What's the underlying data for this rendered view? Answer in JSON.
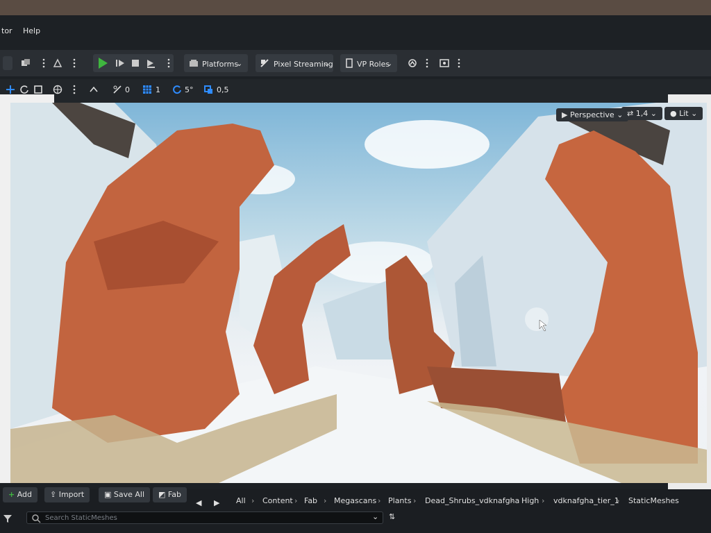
{
  "menu": {
    "partial_left": "tor",
    "help": "Help"
  },
  "toolbar": {
    "platforms": "Platforms",
    "pixel_streaming": "Pixel Streaming",
    "vp_roles": "VP Roles"
  },
  "transform_bar": {
    "rotation_snap": "0",
    "grid_snap": "1",
    "angle_snap": "5°",
    "scale_snap": "0,5"
  },
  "viewport": {
    "view_mode": "Perspective",
    "camera_speed": "1,4",
    "lighting_mode": "Lit"
  },
  "content_browser": {
    "add_label": "Add",
    "import_label": "Import",
    "save_all_label": "Save All",
    "fab_label": "Fab",
    "breadcrumb": [
      "All",
      "Content",
      "Fab",
      "Megascans",
      "Plants",
      "Dead_Shrubs_vdknafgha",
      "High",
      "vdknafgha_tier_1",
      "StaticMeshes"
    ],
    "search_placeholder": "Search StaticMeshes"
  },
  "colors": {
    "play_green": "#3fb63f",
    "add_green": "#3fb63f",
    "toolbar_bg": "#2a2e33",
    "accent_blue": "#2f8cff"
  }
}
